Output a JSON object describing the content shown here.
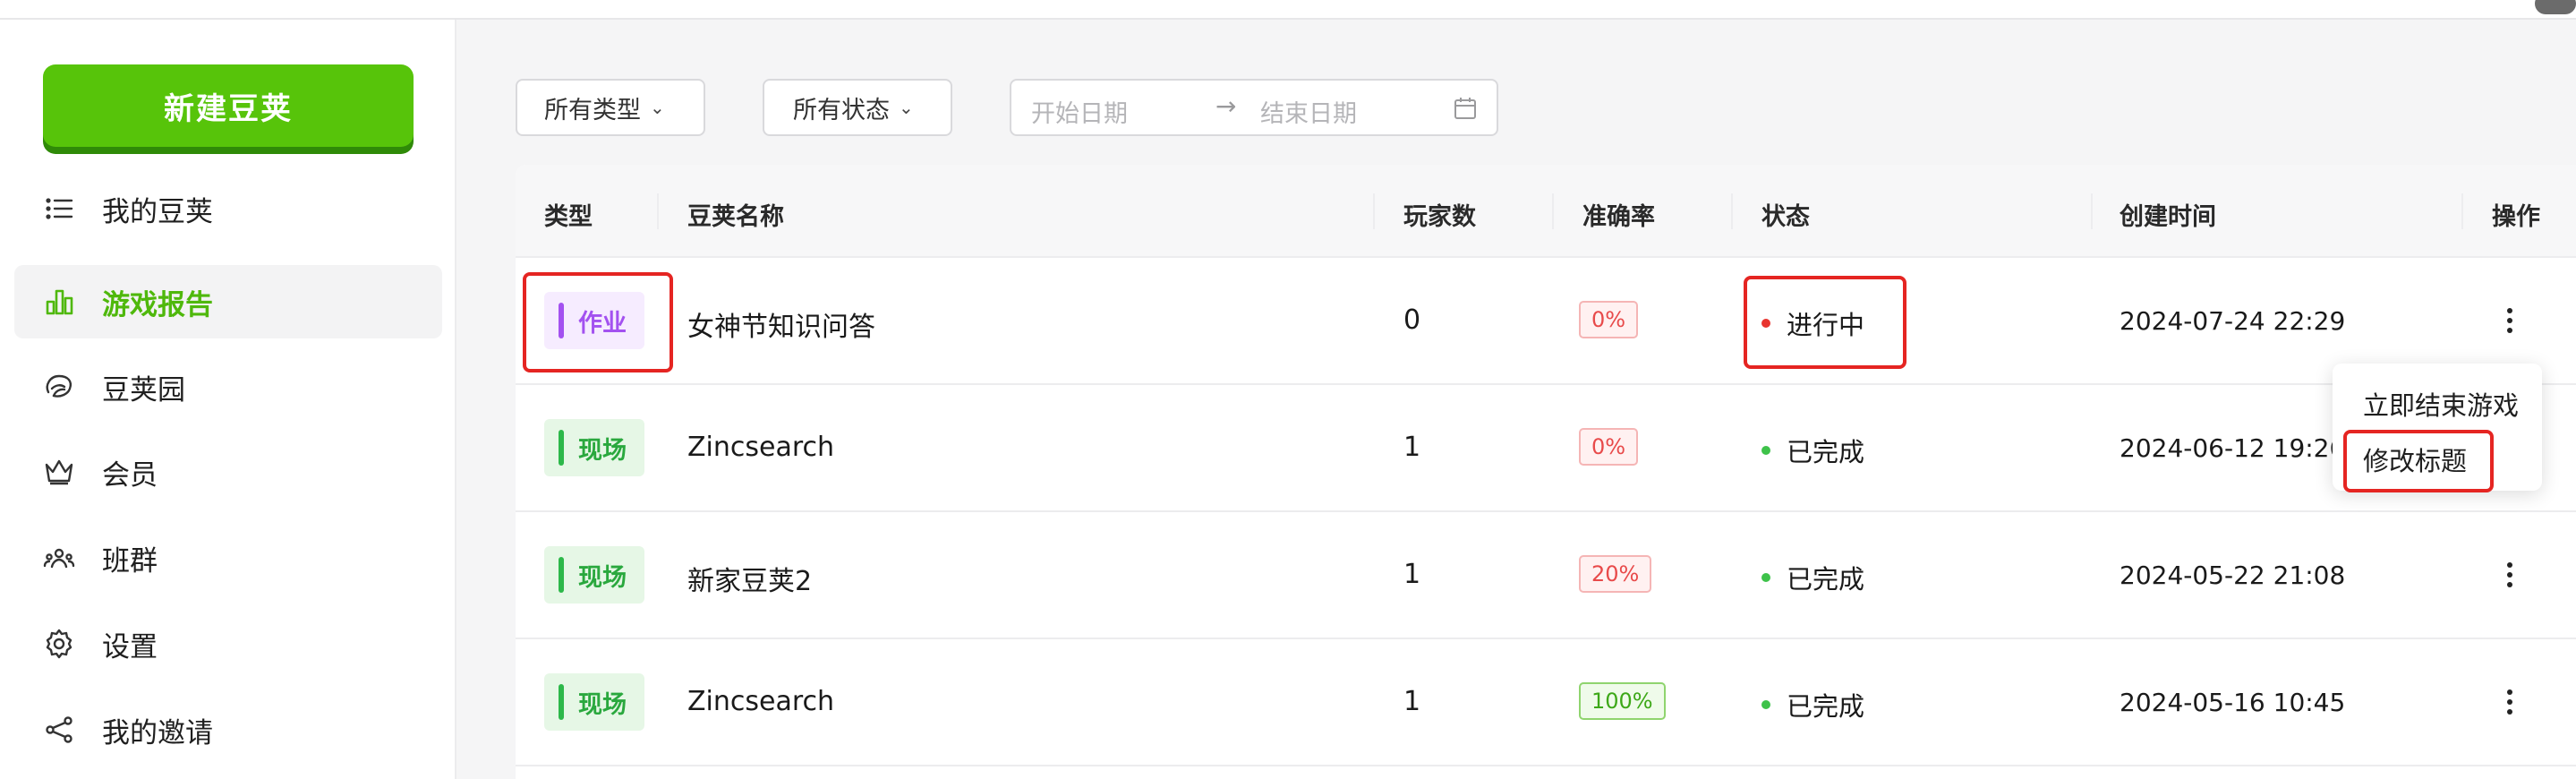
{
  "sidebar": {
    "new_button": "新建豆荚",
    "items": [
      {
        "label": "我的豆荚",
        "icon": "list-icon",
        "active": false
      },
      {
        "label": "游戏报告",
        "icon": "bar-chart-icon",
        "active": true
      },
      {
        "label": "豆荚园",
        "icon": "garden-icon",
        "active": false
      },
      {
        "label": "会员",
        "icon": "crown-icon",
        "active": false
      },
      {
        "label": "班群",
        "icon": "group-icon",
        "active": false
      },
      {
        "label": "设置",
        "icon": "gear-icon",
        "active": false
      },
      {
        "label": "我的邀请",
        "icon": "share-icon",
        "active": false
      }
    ]
  },
  "filters": {
    "type": "所有类型",
    "status": "所有状态",
    "start_placeholder": "开始日期",
    "end_placeholder": "结束日期"
  },
  "table": {
    "headers": [
      "类型",
      "豆荚名称",
      "玩家数",
      "准确率",
      "状态",
      "创建时间",
      "操作"
    ],
    "rows": [
      {
        "type": "作业",
        "name": "女神节知识问答",
        "players": "0",
        "accuracy": "0%",
        "status": "进行中",
        "created": "2024-07-24 22:29"
      },
      {
        "type": "现场",
        "name": "Zincsearch",
        "players": "1",
        "accuracy": "0%",
        "status": "已完成",
        "created": "2024-06-12 19:26"
      },
      {
        "type": "现场",
        "name": "新家豆荚2",
        "players": "1",
        "accuracy": "20%",
        "status": "已完成",
        "created": "2024-05-22 21:08"
      },
      {
        "type": "现场",
        "name": "Zincsearch",
        "players": "1",
        "accuracy": "100%",
        "status": "已完成",
        "created": "2024-05-16 10:45"
      }
    ]
  },
  "dropdown_menu": {
    "items": [
      "立即结束游戏",
      "修改标题"
    ]
  },
  "colors": {
    "brand_green": "#57c40a",
    "active_green": "#4fb80c",
    "homework_purple": "#a351f0",
    "live_green": "#2db84a",
    "highlight_red": "#e52522"
  }
}
